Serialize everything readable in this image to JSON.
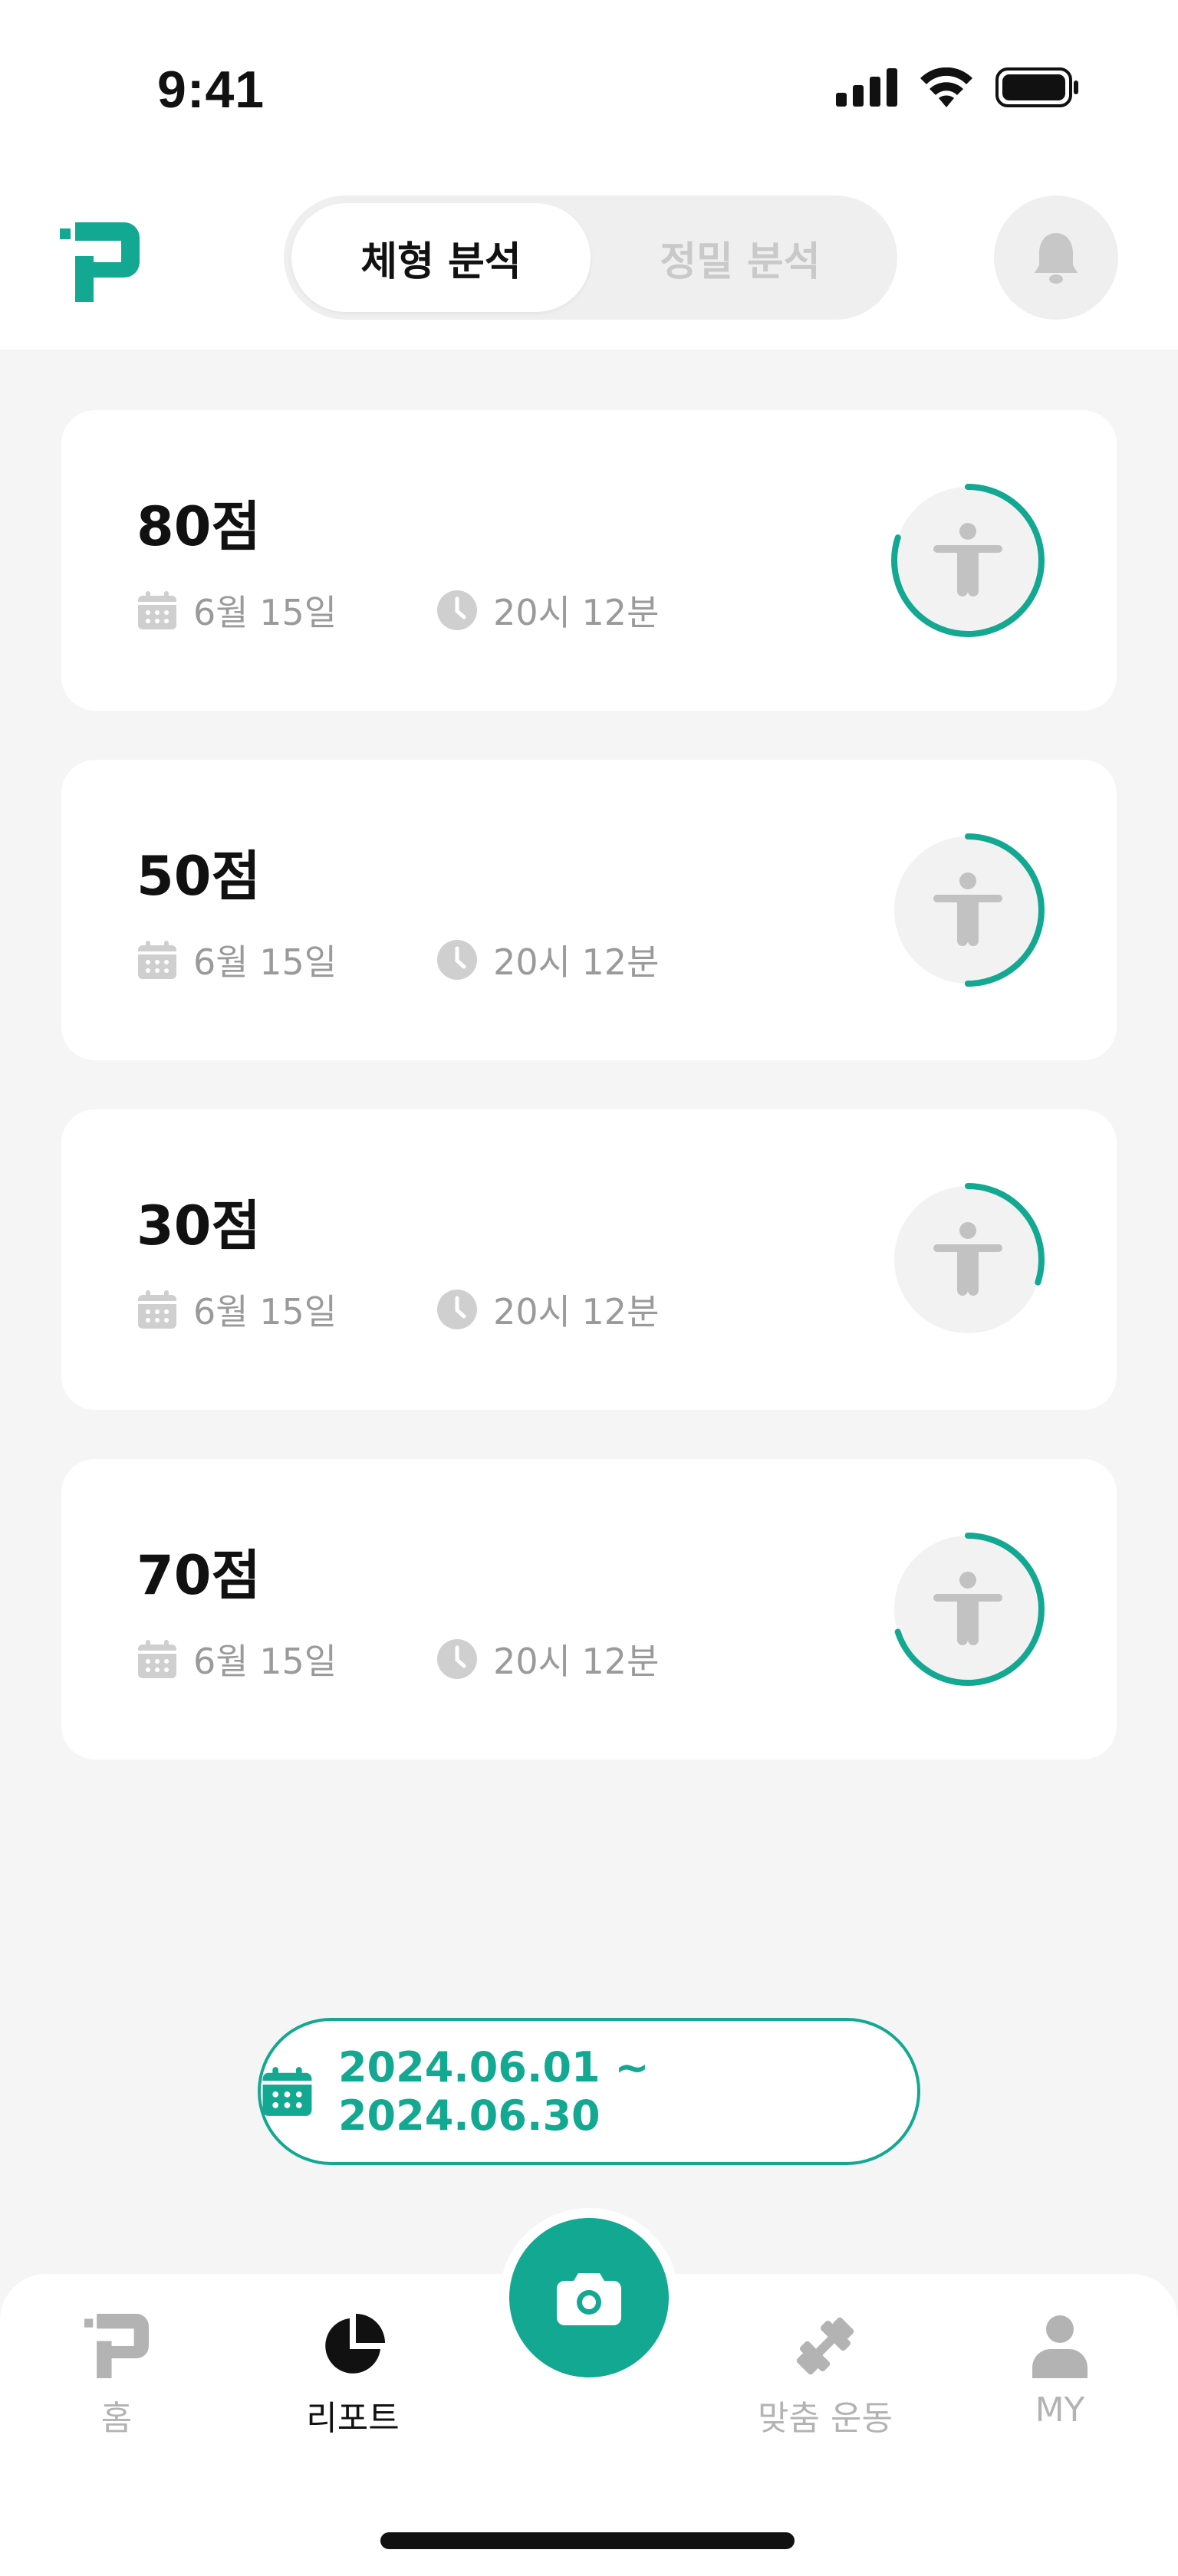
{
  "status_bar": {
    "time": "9:41"
  },
  "header": {
    "tabs": [
      {
        "label": "체형 분석",
        "active": true
      },
      {
        "label": "정밀 분석",
        "active": false
      }
    ],
    "icons": {
      "logo": "brand-logo",
      "notification": "bell-icon"
    }
  },
  "reports": [
    {
      "score": "80점",
      "date": "6월 15일",
      "time": "20시 12분",
      "progress": 0.8
    },
    {
      "score": "50점",
      "date": "6월 15일",
      "time": "20시 12분",
      "progress": 0.5
    },
    {
      "score": "30점",
      "date": "6월 15일",
      "time": "20시 12분",
      "progress": 0.3
    },
    {
      "score": "70점",
      "date": "6월 15일",
      "time": "20시 12분",
      "progress": 0.7
    }
  ],
  "date_range": {
    "label": "2024.06.01 ~ 2024.06.30"
  },
  "tabbar": {
    "items": [
      {
        "label": "홈",
        "icon": "home-logo-icon",
        "active": false
      },
      {
        "label": "리포트",
        "icon": "pie-chart-icon",
        "active": true
      },
      {
        "label": "",
        "icon": "camera-icon",
        "active": false
      },
      {
        "label": "맞춤 운동",
        "icon": "dumbbell-icon",
        "active": false
      },
      {
        "label": "MY",
        "icon": "person-icon",
        "active": false
      }
    ]
  },
  "colors": {
    "accent": "#13a892",
    "background": "#f5f5f5",
    "muted": "#9a9a9a",
    "inactive": "#b3b3b3"
  }
}
